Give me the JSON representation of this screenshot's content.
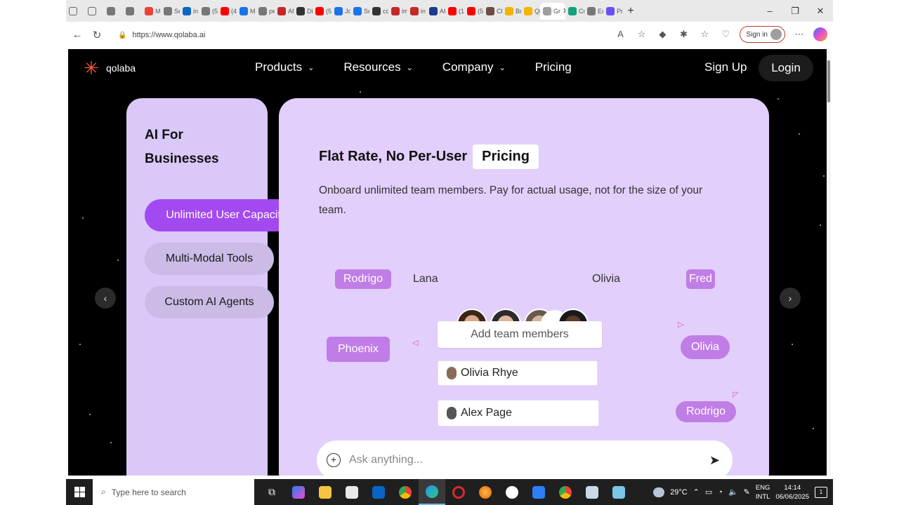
{
  "browser": {
    "tabs": [
      {
        "label": "",
        "color": "#777777"
      },
      {
        "label": "",
        "color": "#777777"
      },
      {
        "label": "M",
        "color": "#ea4335"
      },
      {
        "label": "Se",
        "color": "#777777"
      },
      {
        "label": "in",
        "color": "#0a66c2"
      },
      {
        "label": "(5)",
        "color": "#777777"
      },
      {
        "label": "(4)",
        "color": "#ff0000"
      },
      {
        "label": "M",
        "color": "#1a73e8"
      },
      {
        "label": "pe",
        "color": "#777777"
      },
      {
        "label": "Af",
        "color": "#c62828"
      },
      {
        "label": "Di",
        "color": "#333333"
      },
      {
        "label": "(5)",
        "color": "#ff0000"
      },
      {
        "label": "Jo",
        "color": "#1a73e8"
      },
      {
        "label": "Se",
        "color": "#1a73e8"
      },
      {
        "label": "cc",
        "color": "#333333"
      },
      {
        "label": "im",
        "color": "#c62828"
      },
      {
        "label": "in",
        "color": "#c62828"
      },
      {
        "label": "Af",
        "color": "#1e3a8a"
      },
      {
        "label": "(1",
        "color": "#ff0000"
      },
      {
        "label": "(5",
        "color": "#ff0000"
      },
      {
        "label": "Cl",
        "color": "#6d4c41"
      },
      {
        "label": "Br",
        "color": "#f4b400"
      },
      {
        "label": "Qi",
        "color": "#f4b400"
      },
      {
        "label": "Gr",
        "color": "#9e9e9e",
        "active": true
      },
      {
        "label": "Cr",
        "color": "#10a37f"
      },
      {
        "label": "Ec",
        "color": "#777777"
      },
      {
        "label": "Pr",
        "color": "#6a4ff5"
      }
    ],
    "url": "https://www.qolaba.ai",
    "signin_label": "Sign in"
  },
  "site": {
    "logo_text": "qolaba",
    "nav": [
      {
        "label": "Products",
        "dropdown": true
      },
      {
        "label": "Resources",
        "dropdown": true
      },
      {
        "label": "Company",
        "dropdown": true
      },
      {
        "label": "Pricing",
        "dropdown": false
      }
    ],
    "signup": "Sign Up",
    "login": "Login"
  },
  "left_panel": {
    "title": "AI For Businesses",
    "items": [
      {
        "label": "Unlimited User Capacity",
        "active": true
      },
      {
        "label": "Multi-Modal Tools",
        "active": false
      },
      {
        "label": "Custom AI Agents",
        "active": false
      }
    ]
  },
  "main_panel": {
    "headline": "Flat Rate, No Per-User",
    "headline_chip": "Pricing",
    "description": "Onboard unlimited team members. Pay for actual usage, not for the size of your team.",
    "names": {
      "rodrigo_top": "Rodrigo",
      "lana": "Lana",
      "olivia_top": "Olivia",
      "fred": "Fred",
      "phoenix": "Phoenix",
      "olivia_right": "Olivia",
      "rodrigo_right": "Rodrigo"
    },
    "add_members": "Add team members",
    "members": [
      "Olivia Rhye",
      "Alex Page"
    ],
    "ask_placeholder": "Ask anything..."
  },
  "taskbar": {
    "search_placeholder": "Type here to search",
    "weather": "29°C",
    "lang_top": "ENG",
    "lang_bottom": "INTL",
    "time": "14:14",
    "date": "06/06/2025",
    "notification_count": "1"
  }
}
